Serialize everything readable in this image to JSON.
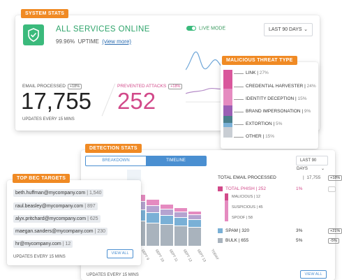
{
  "system_stats": {
    "tag": "SYSTEM STATS",
    "status": "ALL SERVICES ONLINE",
    "uptime_value": "99.96%",
    "uptime_label": "UPTIME",
    "view_more": "(view more)",
    "live_mode": "LIVE MODE",
    "range": "LAST 90 DAYS",
    "email_processed_label": "EMAIL PROCESSED",
    "email_processed_pct": "+18%",
    "email_processed_value": "17,755",
    "prevented_label": "PREVENTED ATTACKS",
    "prevented_pct": "+18%",
    "prevented_value": "252",
    "footer": "UPDATES EVERY 15 MINS"
  },
  "threat_types": {
    "tag": "MALICIOUS THREAT TYPE",
    "items": [
      {
        "label": "LINK",
        "value": "27%",
        "color": "#d9579c"
      },
      {
        "label": "CREDENTIAL HARVESTER",
        "value": "24%",
        "color": "#e58bc0"
      },
      {
        "label": "IDENTITY DECEPTION",
        "value": "15%",
        "color": "#9b5fb5"
      },
      {
        "label": "BRAND IMPERSONATION",
        "value": "9%",
        "color": "#4a7f8c"
      },
      {
        "label": "EXTORTION",
        "value": "5%",
        "color": "#7ab0d6"
      },
      {
        "label": "OTHER",
        "value": "15%",
        "color": "#c9ced4"
      }
    ]
  },
  "detection": {
    "tag": "DETECTION STATS",
    "tab_breakdown": "BREAKDOWN",
    "tab_timeline": "TIMELINE",
    "range": "LAST 90 DAYS",
    "total_label": "TOTAL EMAIL PROCESSED",
    "total_value": "17,755",
    "total_badge": "+18%",
    "phish_label": "TOTAL PHISH",
    "phish_value": "252",
    "phish_pct": "1%",
    "malicious_label": "MALICIOUS",
    "malicious_value": "12",
    "suspicious_label": "SUSPICIOUS",
    "suspicious_value": "45",
    "spoof_label": "SPOOF",
    "spoof_value": "58",
    "spam_label": "SPAM",
    "spam_value": "320",
    "spam_pct": "3%",
    "spam_badge": "+21%",
    "bulk_label": "BULK",
    "bulk_value": "655",
    "bulk_pct": "5%",
    "bulk_badge": "-5%",
    "footer": "UPDATES EVERY 15 MINS",
    "view_all": "VIEW ALL",
    "x_labels": [
      "SEPT 9",
      "SEPT 10",
      "SEPT 11",
      "SEPT 12",
      "SEPT 13",
      "TODAY"
    ]
  },
  "bec": {
    "tag": "TOP BEC TARGETS",
    "items": [
      {
        "email": "beth.huffman@mycompany.com",
        "count": "1,540"
      },
      {
        "email": "raul.beasley@mycompany.com",
        "count": "897"
      },
      {
        "email": "alyx.pritchard@mycompany.com",
        "count": "625"
      },
      {
        "email": "maegan.sanders@mycompany.com",
        "count": "230"
      },
      {
        "email": "hr@mycompany.com",
        "count": "12"
      }
    ],
    "footer": "UPDATES EVERY 15 MINS",
    "view_all": "VIEW ALL"
  }
}
